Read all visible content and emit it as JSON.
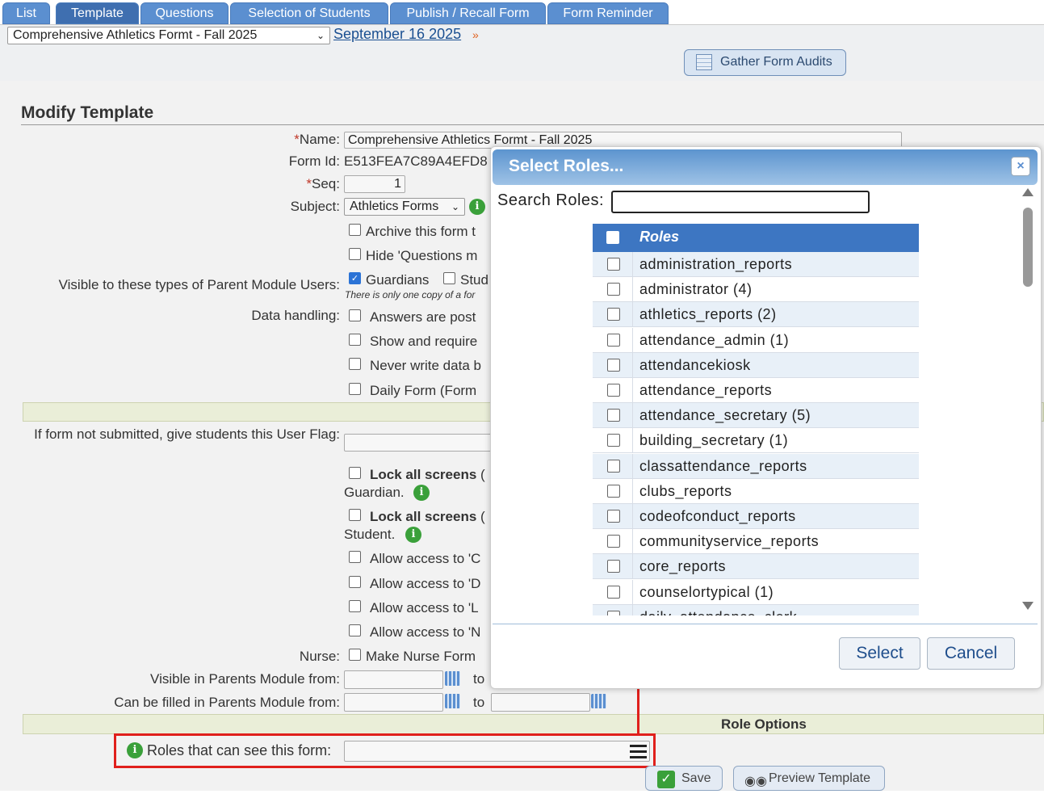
{
  "tabs": [
    "List",
    "Template",
    "Questions",
    "Selection of Students",
    "Publish / Recall Form",
    "Form Reminder"
  ],
  "form_select": "Comprehensive Athletics Formt - Fall 2025",
  "date_link": "September 16 2025",
  "date_arrow": "»",
  "gather_button": "Gather Form Audits",
  "heading": "Modify Template",
  "labels": {
    "name": "Name:",
    "name_req": "*",
    "form_id": "Form Id:",
    "seq": "Seq:",
    "seq_req": "*",
    "subject": "Subject:",
    "visible_types": "Visible to these types of Parent Module Users:",
    "data_handling": "Data handling:",
    "user_flag": "If form not submitted, give students this User Flag:",
    "nurse": "Nurse:",
    "visible_from": "Visible in Parents Module from:",
    "filled_from": "Can be filled in Parents Module from:",
    "to": "to",
    "roles_see": "Roles that can see this form:"
  },
  "values": {
    "name": "Comprehensive Athletics Formt - Fall 2025",
    "form_id": "E513FEA7C89A4EFD8",
    "seq": "1",
    "subject": "Athletics Forms"
  },
  "checkbox_texts": {
    "archive": "Archive this form t",
    "hide_questions": "Hide 'Questions m",
    "guardians": "Guardians",
    "students": "Stud",
    "note": "There is only one copy of a for",
    "answers_posted": "Answers are post",
    "show_require": "Show and require",
    "never_write": "Never write data b",
    "daily_form": "Daily Form (Form",
    "lock_all_bold": "Lock all screens",
    "lock_paren": "(",
    "guardian_tail": "Guardian.",
    "student_tail": "Student.",
    "allow_c": "Allow access to 'C",
    "allow_d": "Allow access to 'D",
    "allow_l": "Allow access to 'L",
    "allow_n": "Allow access to 'N",
    "nurse_form": "Make Nurse Form"
  },
  "role_options_band": "Role Options",
  "save_button": "Save",
  "preview_button": "Preview Template",
  "modal": {
    "title": "Select Roles...",
    "close": "×",
    "search_label": "Search Roles:",
    "search_value": "",
    "header": "Roles",
    "roles": [
      "administration_reports",
      "administrator (4)",
      "athletics_reports (2)",
      "attendance_admin (1)",
      "attendancekiosk",
      "attendance_reports",
      "attendance_secretary (5)",
      "building_secretary (1)",
      "classattendance_reports",
      "clubs_reports",
      "codeofconduct_reports",
      "communityservice_reports",
      "core_reports",
      "counselortypical (1)",
      "daily_attendance_clerk"
    ],
    "select_button": "Select",
    "cancel_button": "Cancel"
  },
  "colors": {
    "tab": "#5b8fd0",
    "modal_header": "#5c94cf",
    "table_header": "#3d76c2",
    "annotation": "#e0201c",
    "info": "#3aa03a"
  }
}
